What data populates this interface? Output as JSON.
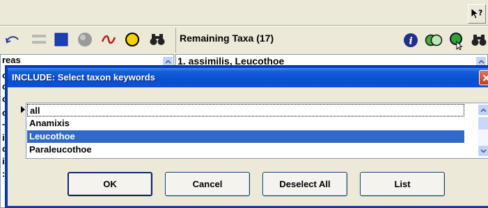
{
  "background_app": {
    "help_button_icon": "help-pointer-icon",
    "left_toolbar_icons": [
      "undo-arrow-icon",
      "grey-bars-icon",
      "blue-square-icon",
      "grey-blob-icon",
      "red-tilde-icon",
      "yellow-circle-icon",
      "binoculars-icon"
    ],
    "remaining_title": "Remaining Taxa (17)",
    "right_toolbar_icons": [
      "info-icon",
      "green-overlap-icon",
      "green-circle-icon",
      "binoculars-icon"
    ],
    "left_list_fragments": [
      "reas",
      "oy",
      "os",
      "oy",
      "o",
      "-",
      "iz",
      "cr",
      "ir",
      ":"
    ],
    "right_list_first_item": "1. assimilis, Leucothoe"
  },
  "dialog": {
    "title": "INCLUDE: Select taxon keywords",
    "keywords": [
      {
        "label": "all",
        "state": "current"
      },
      {
        "label": "Anamixis",
        "state": "normal"
      },
      {
        "label": "Leucothoe",
        "state": "selected"
      },
      {
        "label": "Paraleucothoe",
        "state": "normal"
      }
    ],
    "buttons": {
      "ok": "OK",
      "cancel": "Cancel",
      "deselect_all": "Deselect All",
      "list": "List"
    }
  },
  "colors": {
    "selection": "#316AC5",
    "titlebar": "#0A4ECF",
    "window_bg": "#ECE9D8"
  }
}
